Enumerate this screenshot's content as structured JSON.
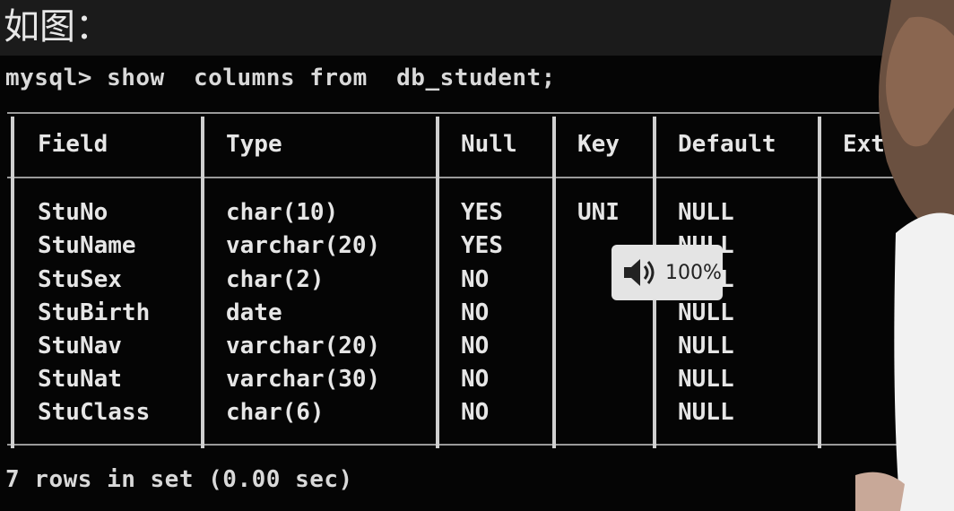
{
  "caption": "如图：",
  "command": "mysql> show  columns from  db_student;",
  "headers": [
    "Field",
    "Type",
    "Null",
    "Key",
    "Default",
    "Extra"
  ],
  "rows": [
    [
      "StuNo",
      "char(10)",
      "YES",
      "UNI",
      "NULL",
      ""
    ],
    [
      "StuName",
      "varchar(20)",
      "YES",
      "",
      "NULL",
      ""
    ],
    [
      "StuSex",
      "char(2)",
      "NO",
      "",
      "NULL",
      ""
    ],
    [
      "StuBirth",
      "date",
      "NO",
      "",
      "NULL",
      ""
    ],
    [
      "StuNav",
      "varchar(20)",
      "NO",
      "",
      "NULL",
      ""
    ],
    [
      "StuNat",
      "varchar(30)",
      "NO",
      "",
      "NULL",
      ""
    ],
    [
      "StuClass",
      "char(6)",
      "NO",
      "",
      "NULL",
      ""
    ]
  ],
  "footer": "7 rows in set (0.00 sec)",
  "volume": {
    "label": "100%",
    "icon": "speaker-icon"
  },
  "colors": {
    "terminal_bg": "#050505",
    "text": "#e6e6e6",
    "osd_bg": "#e4e4e4"
  }
}
